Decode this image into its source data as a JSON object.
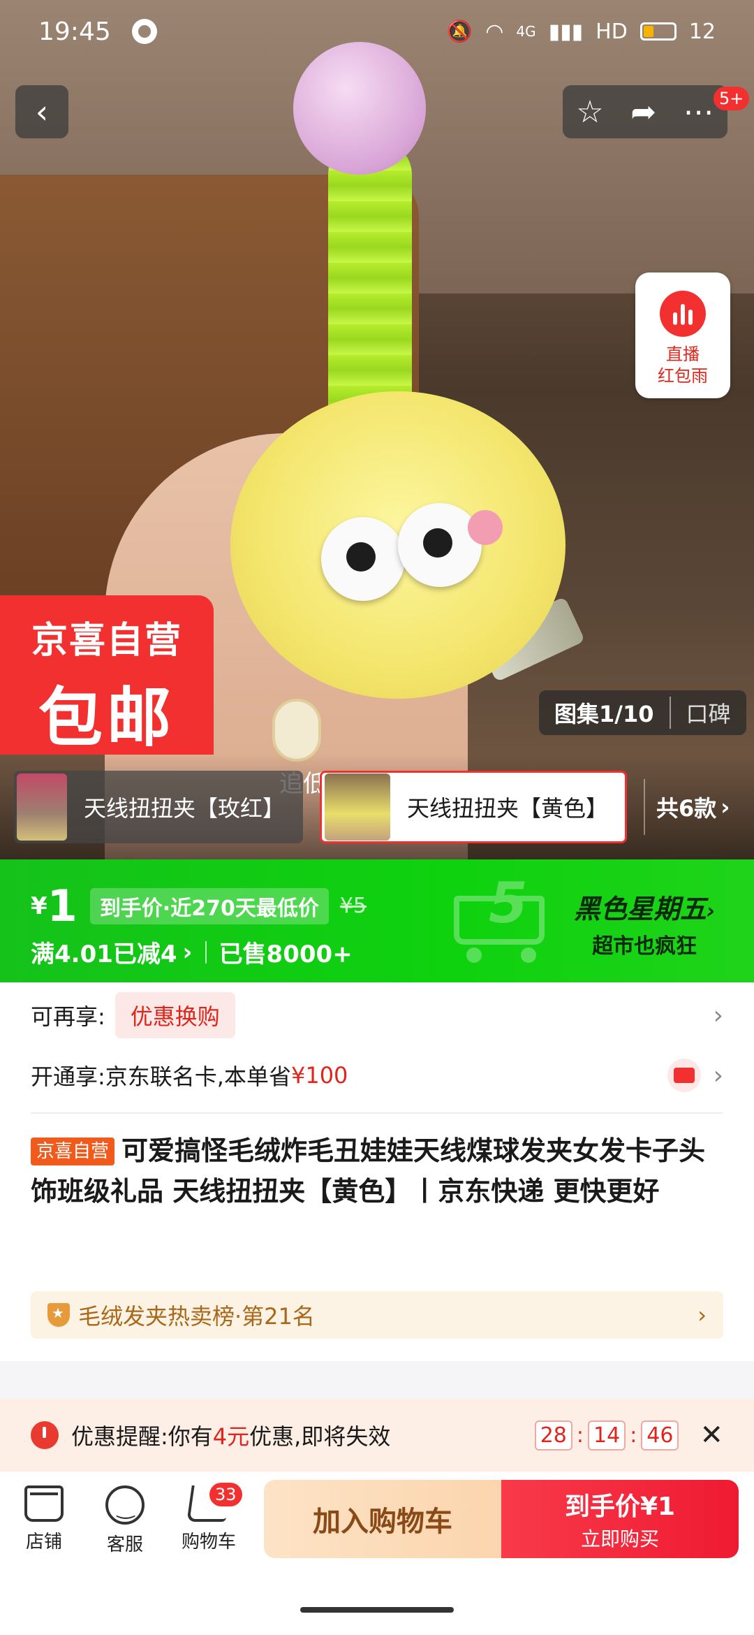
{
  "status_bar": {
    "time": "19:45",
    "network": "4G",
    "hd": "HD",
    "battery": "12"
  },
  "nav": {
    "back_glyph": "‹",
    "more_badge": "5+"
  },
  "live": {
    "label_line1": "直播",
    "label_line2": "红包雨"
  },
  "hero": {
    "badge_line1": "京喜自营",
    "badge_line2": "包邮",
    "gallery_label": "图集1/10",
    "reviews_label": "口碑",
    "overlay_text": "追低点的鲸"
  },
  "variants": {
    "items": [
      {
        "label": "天线扭扭夹【玫红】"
      },
      {
        "label": "天线扭扭夹【黄色】"
      }
    ],
    "more_label": "共6款"
  },
  "price": {
    "currency": "¥",
    "value": "1",
    "tag": "到手价·近270天最低价",
    "original": "¥5",
    "discount": "满4.01已减4",
    "sold": "已售8000+",
    "promo_title": "黑色星期五",
    "promo_sub": "超市也疯狂",
    "promo_number": "5"
  },
  "reshare": {
    "label": "可再享:",
    "pill": "优惠换购"
  },
  "card_offer": {
    "prefix": "开通享:京东联名卡,本单省",
    "amount": "¥100"
  },
  "product": {
    "tag": "京喜自营",
    "title": "可爱搞怪毛绒炸毛丑娃娃天线煤球发夹女发卡子头饰班级礼品 天线扭扭夹【黄色】丨京东快递 更快更好"
  },
  "rank": {
    "text": "毛绒发夹热卖榜·第21名"
  },
  "reminder": {
    "prefix": "优惠提醒:你有",
    "amount": "4元",
    "suffix": "优惠,即将失效",
    "hours": "28",
    "minutes": "14",
    "seconds": "46"
  },
  "bottom_nav": {
    "store": "店铺",
    "service": "客服",
    "cart": "购物车",
    "cart_count": "33",
    "add_to_cart": "加入购物车",
    "buy_line1": "到手价¥1",
    "buy_line2": "立即购买"
  },
  "colors": {
    "accent_red": "#f23030",
    "promo_green": "#15c21a",
    "self_op_orange": "#f25a1c"
  }
}
